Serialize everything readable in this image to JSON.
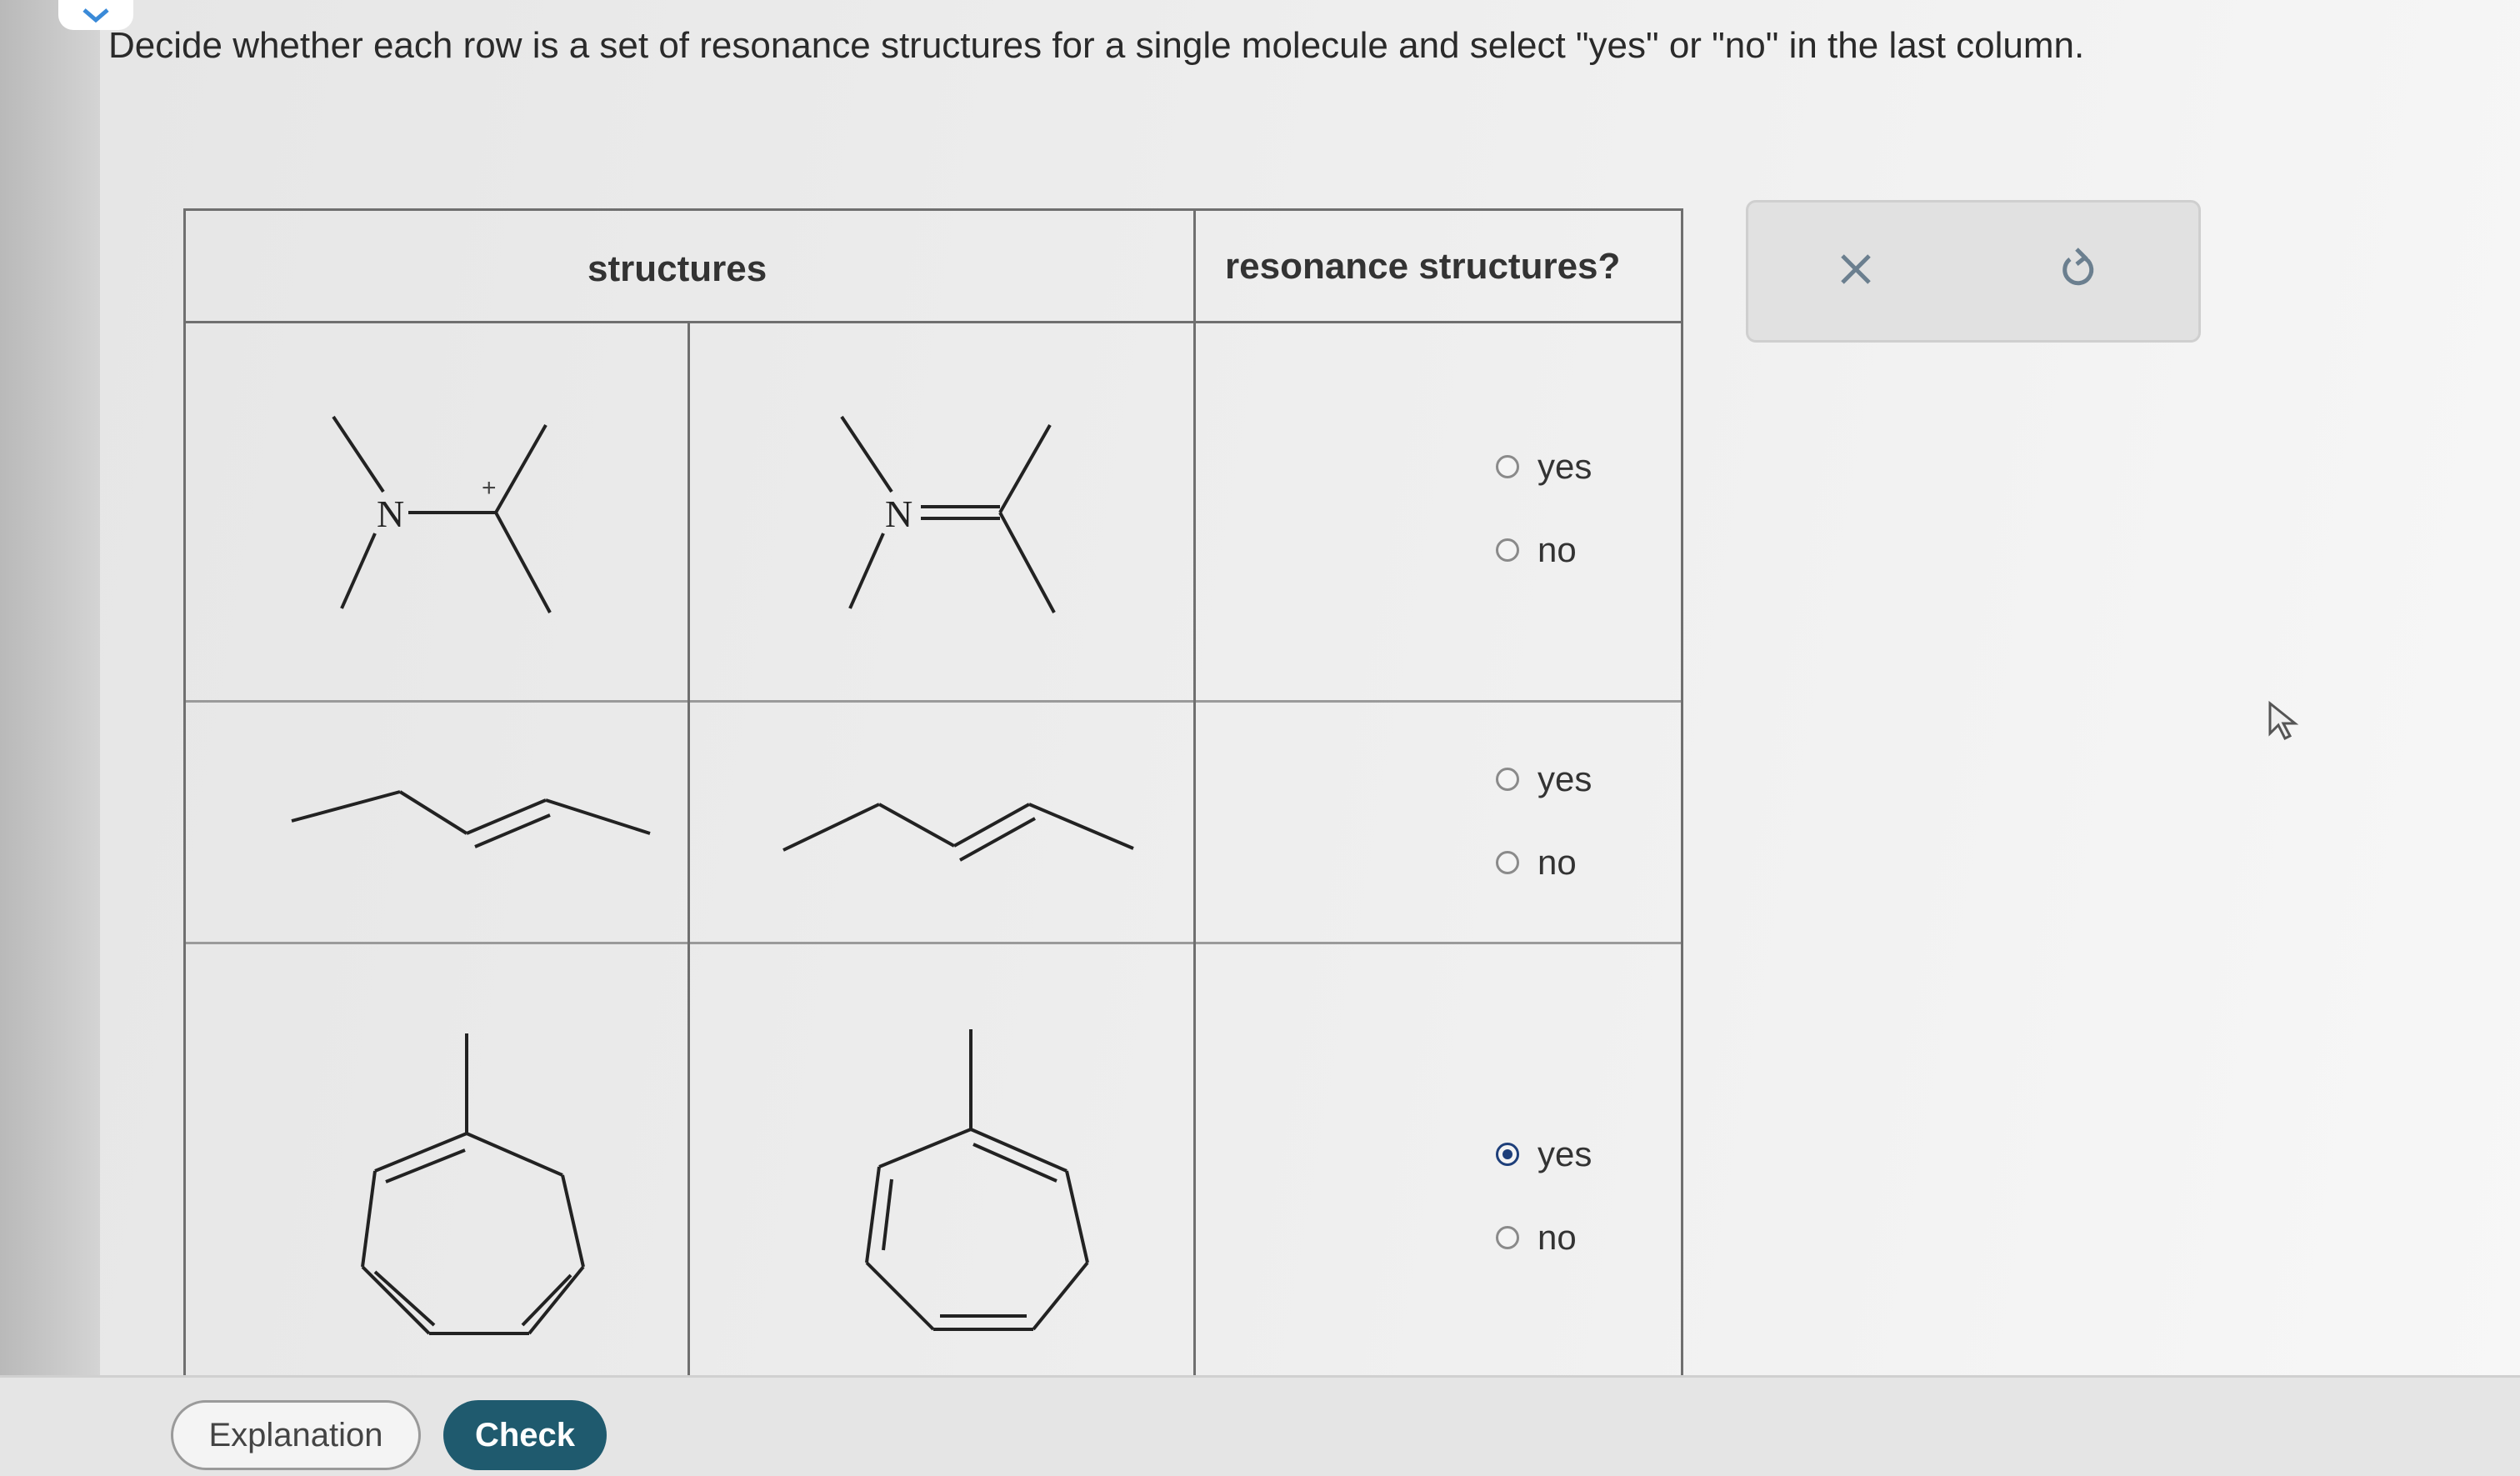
{
  "instruction": "Decide whether each row is a set of resonance structures for a single molecule and select \"yes\" or \"no\" in the last column.",
  "table": {
    "header_structures": "structures",
    "header_resonance": "resonance structures?",
    "rows": [
      {
        "atom_label_left": "N",
        "charge_left": "+",
        "atom_label_right": "N",
        "options": [
          "yes",
          "no"
        ],
        "selected": null
      },
      {
        "options": [
          "yes",
          "no"
        ],
        "selected": null
      },
      {
        "options": [
          "yes",
          "no"
        ],
        "selected": "yes"
      }
    ]
  },
  "actions": {
    "clear_icon": "x-icon",
    "undo_icon": "undo-icon"
  },
  "buttons": {
    "explanation": "Explanation",
    "check": "Check"
  },
  "colors": {
    "check_button": "#1f5a6e",
    "radio_selected": "#1e3f7a",
    "icon": "#6b7f8f"
  }
}
